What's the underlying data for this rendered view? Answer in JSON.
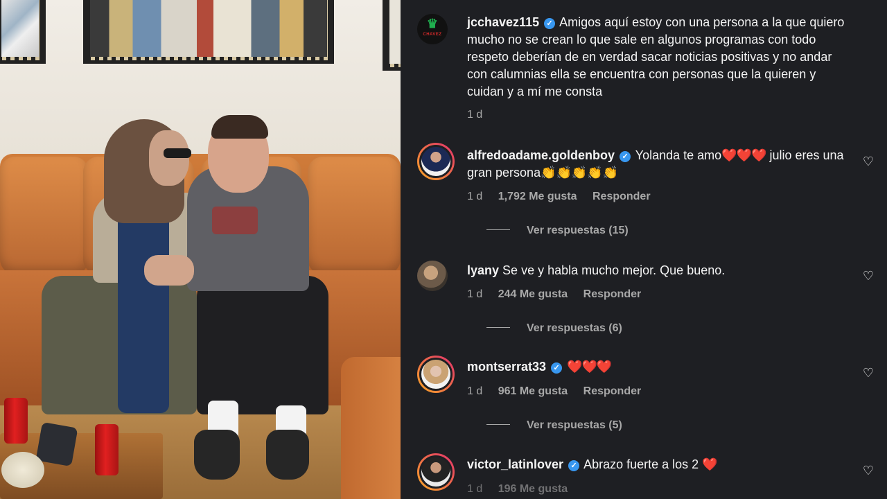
{
  "post": {
    "username": "jcchavez115",
    "verified_mark": "✓",
    "logo_text": "CHAVEZ",
    "caption": "Amigos aquí estoy con una persona a la que quiero mucho no se crean lo que sale en algunos programas con todo respeto deberían de en verdad sacar noticias positivas y no andar con calumnias ella se encuentra con personas que la quieren y cuidan y a mí me consta",
    "time": "1 d"
  },
  "comments": [
    {
      "username": "alfredoadame.goldenboy",
      "verified": true,
      "text_before": "Yolanda te amo",
      "hearts": "❤️❤️❤️",
      "text_after": " julio eres una gran persona",
      "emoji": "👏👏👏👏👏",
      "time": "1 d",
      "likes": "1,792 Me gusta",
      "reply": "Responder",
      "view_replies": "Ver respuestas (15)"
    },
    {
      "username": "lyany",
      "verified": false,
      "text": "Se ve y habla mucho mejor. Que bueno.",
      "time": "1 d",
      "likes": "244 Me gusta",
      "reply": "Responder",
      "view_replies": "Ver respuestas (6)"
    },
    {
      "username": "montserrat33",
      "verified": true,
      "hearts": "❤️❤️❤️",
      "time": "1 d",
      "likes": "961 Me gusta",
      "reply": "Responder",
      "view_replies": "Ver respuestas (5)"
    },
    {
      "username": "victor_latinlover",
      "verified": true,
      "text": "Abrazo fuerte a los 2 ",
      "hearts": "❤️",
      "time": "1 d",
      "likes": "196 Me gusta"
    }
  ],
  "icons": {
    "like": "heart-outline-icon",
    "verified": "verified-badge-icon"
  },
  "colors": {
    "panel_bg": "#1e1f23",
    "text": "#f4f4f4",
    "muted": "#a8a8a8",
    "verified": "#3897f0",
    "heart": "#e0245e"
  }
}
